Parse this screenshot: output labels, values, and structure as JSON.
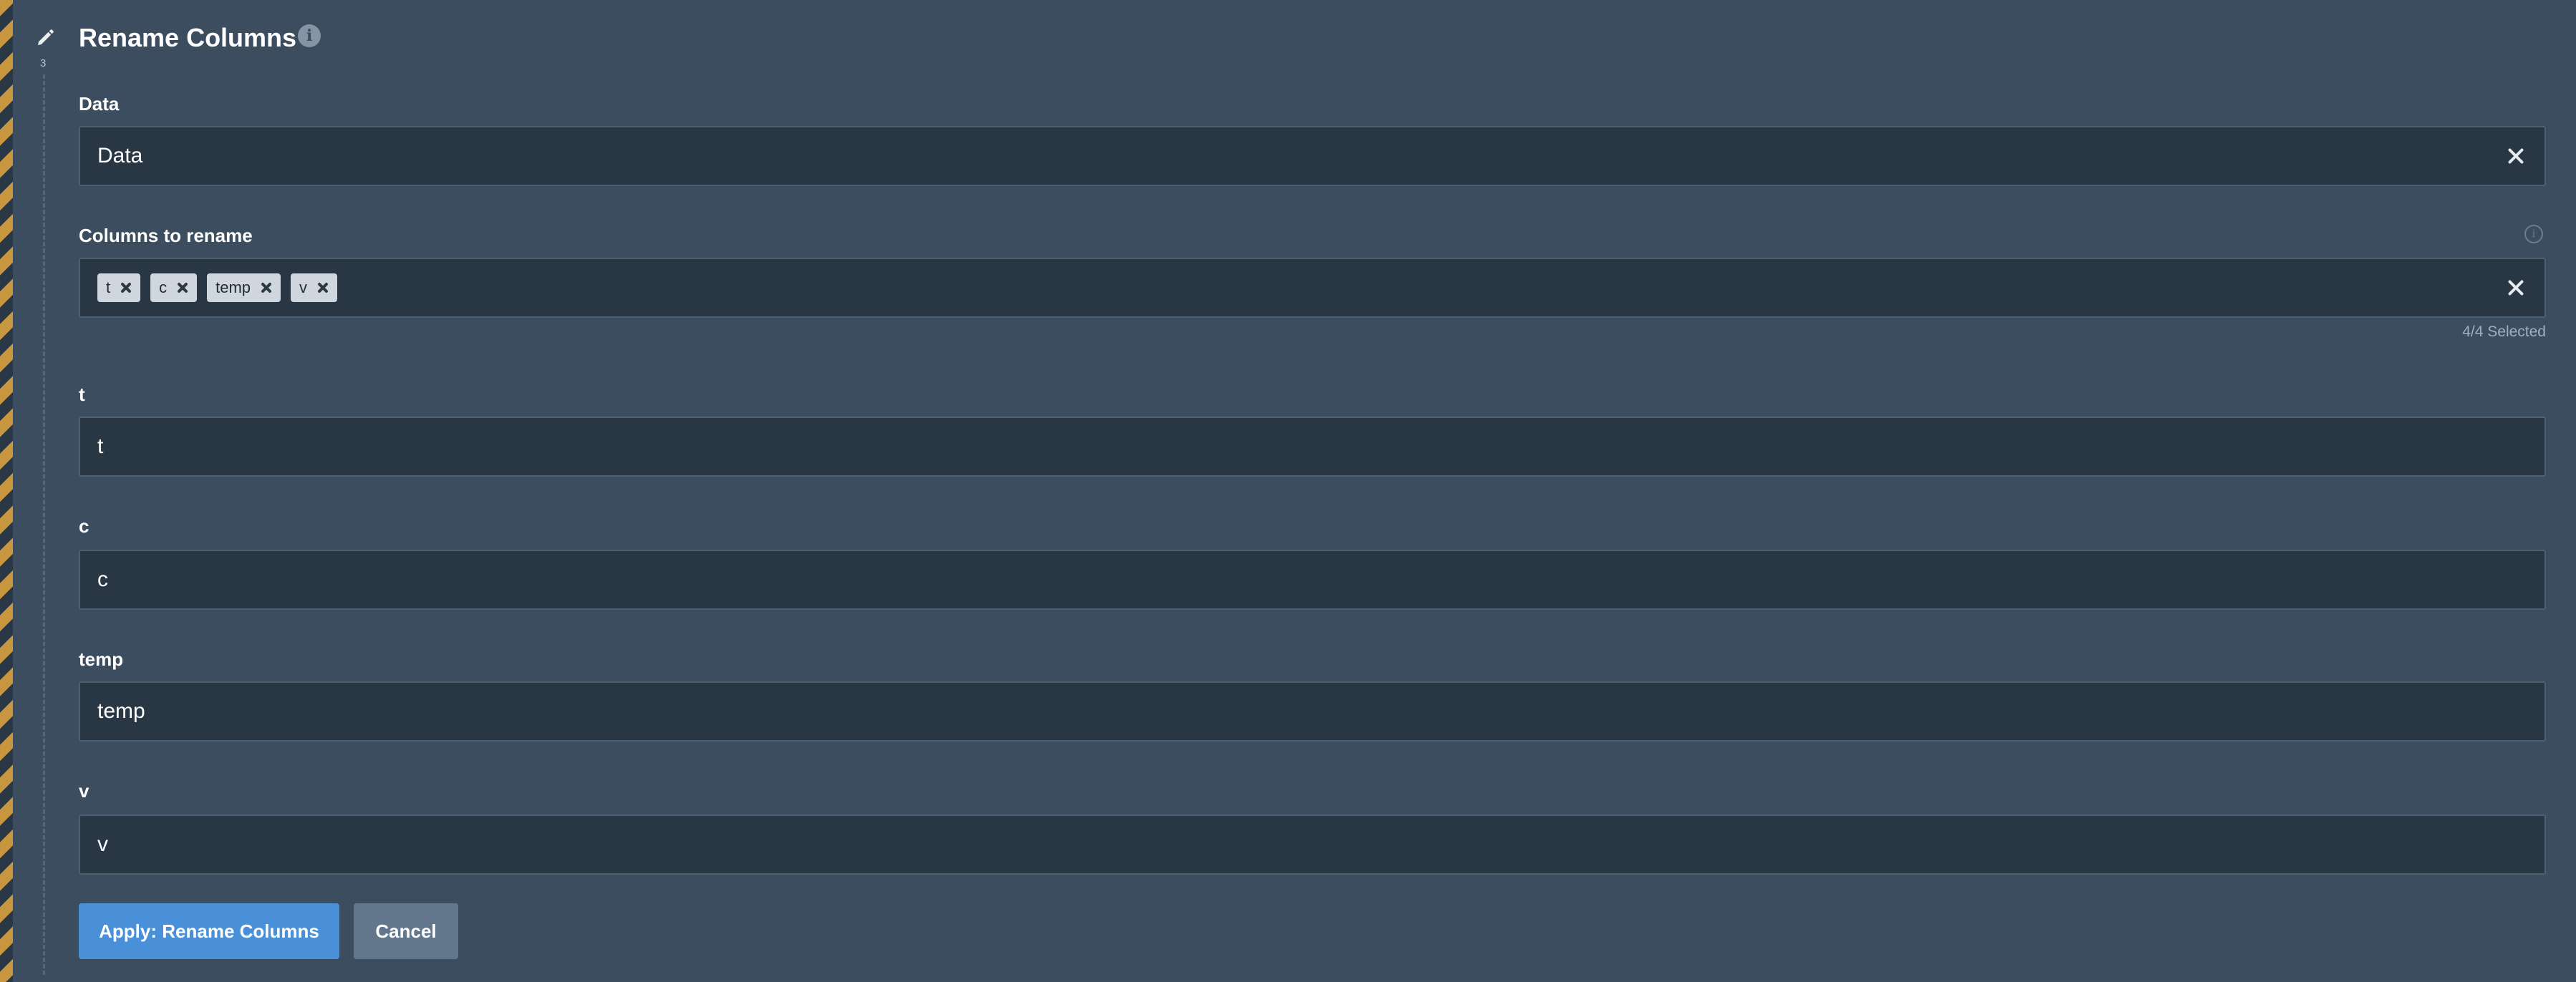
{
  "step": {
    "number": "3",
    "icon": "pencil-icon"
  },
  "title": "Rename Columns",
  "fields": {
    "data": {
      "label": "Data",
      "value": "Data"
    },
    "columns_to_rename": {
      "label": "Columns to rename",
      "chips": [
        "t",
        "c",
        "temp",
        "v"
      ],
      "selected_count": "4/4 Selected"
    },
    "t": {
      "label": "t",
      "value": "t"
    },
    "c": {
      "label": "c",
      "value": "c"
    },
    "temp": {
      "label": "temp",
      "value": "temp"
    },
    "v": {
      "label": "v",
      "value": "v"
    }
  },
  "buttons": {
    "apply": "Apply: Rename Columns",
    "cancel": "Cancel"
  },
  "colors": {
    "background": "#3b4d5e",
    "field_background": "#293745",
    "accent": "#4a90d9",
    "stripe": "#c8963e"
  }
}
